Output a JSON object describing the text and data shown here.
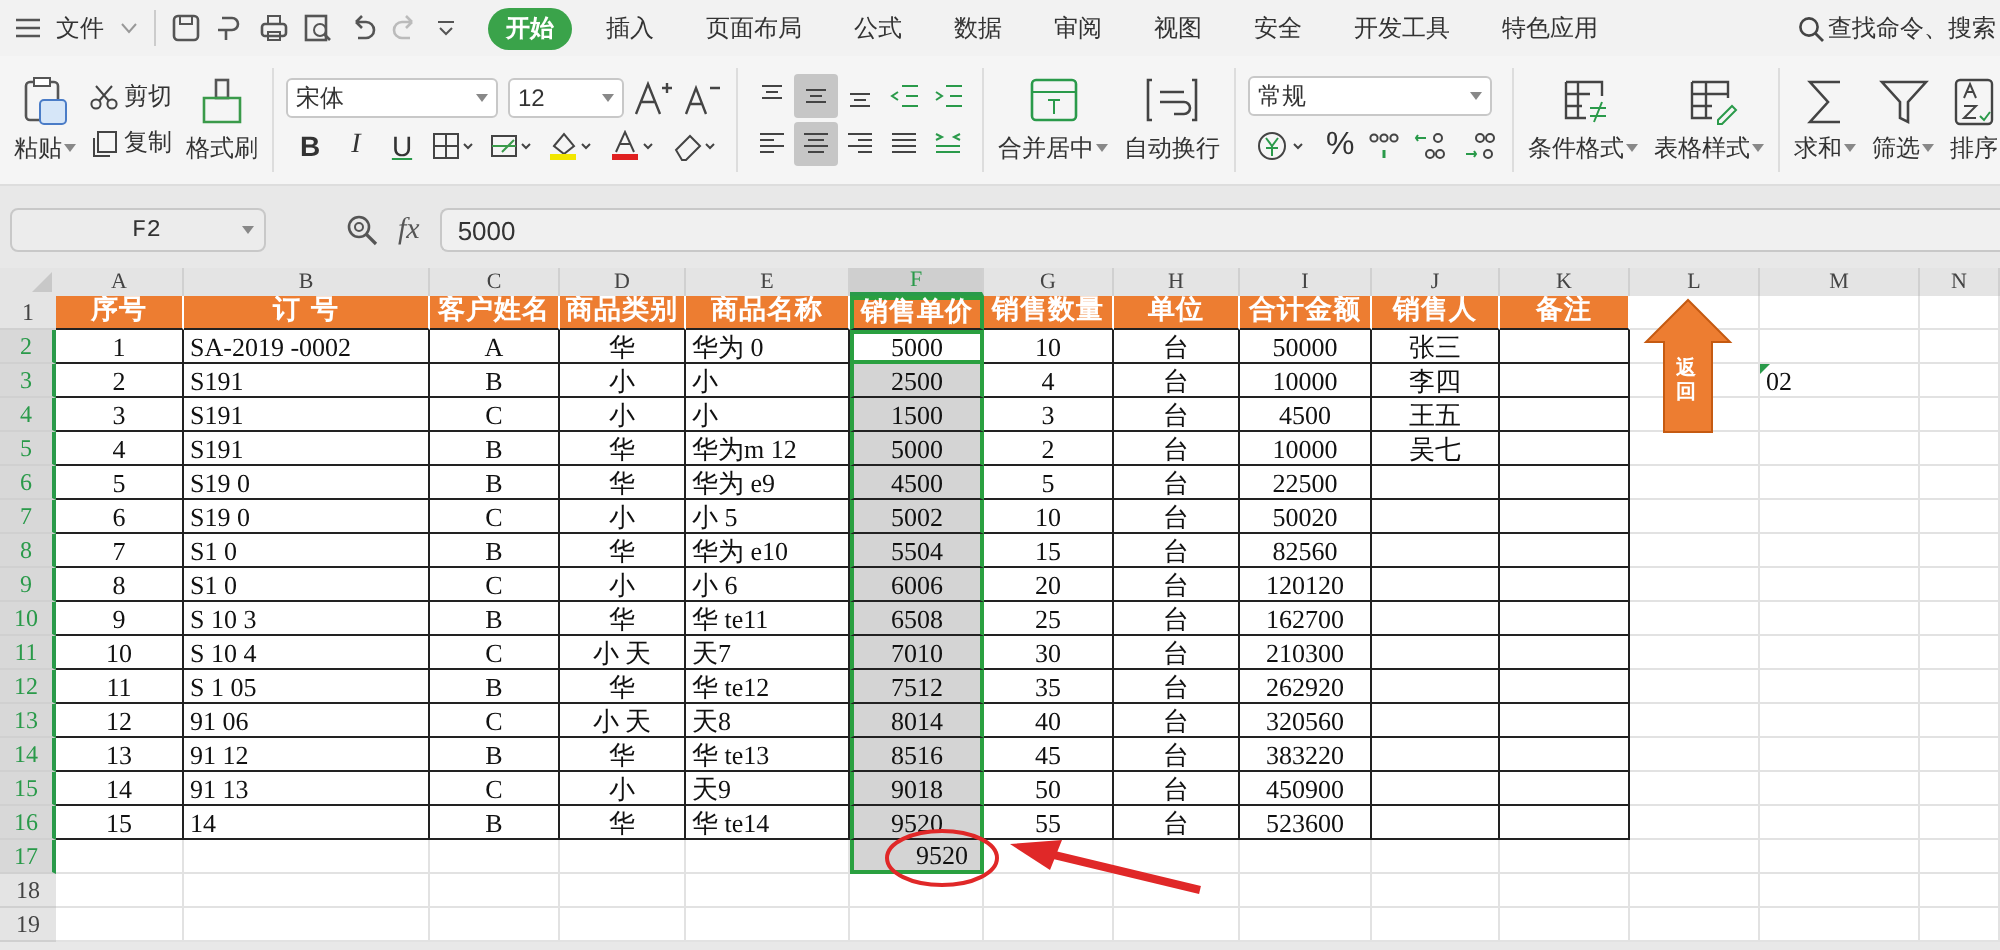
{
  "menu": {
    "file": "文件",
    "tabs": [
      {
        "label": "开始",
        "selected": true
      },
      {
        "label": "插入",
        "selected": false
      },
      {
        "label": "页面布局",
        "selected": false
      },
      {
        "label": "公式",
        "selected": false
      },
      {
        "label": "数据",
        "selected": false
      },
      {
        "label": "审阅",
        "selected": false
      },
      {
        "label": "视图",
        "selected": false
      },
      {
        "label": "安全",
        "selected": false
      },
      {
        "label": "开发工具",
        "selected": false
      },
      {
        "label": "特色应用",
        "selected": false
      }
    ],
    "search": "查找命令、搜索"
  },
  "ribbon": {
    "paste": "粘贴",
    "cut": "剪切",
    "copy": "复制",
    "format_painter": "格式刷",
    "font": "宋体",
    "size": "12",
    "bold": "B",
    "italic": "I",
    "underline": "U",
    "align": [
      {
        "kind": "top",
        "selected": false
      },
      {
        "kind": "middle",
        "selected": true
      },
      {
        "kind": "bottom",
        "selected": false
      },
      {
        "kind": "outdent",
        "selected": false
      },
      {
        "kind": "indent",
        "selected": false
      },
      {
        "kind": "left",
        "selected": false
      },
      {
        "kind": "center",
        "selected": true
      },
      {
        "kind": "right",
        "selected": false
      },
      {
        "kind": "justify",
        "selected": false
      },
      {
        "kind": "distribute",
        "selected": false
      }
    ],
    "merge": "合并居中",
    "wrap": "自动换行",
    "number_format": "常规",
    "percent": "%",
    "conditional": "条件格式",
    "table_style": "表格样式",
    "sum": "求和",
    "filter": "筛选",
    "sort": "排序"
  },
  "formula_bar": {
    "cell": "F2",
    "fx": "fx",
    "value": "5000"
  },
  "sheet": {
    "columns": [
      {
        "letter": "A",
        "selected": false
      },
      {
        "letter": "B",
        "selected": false
      },
      {
        "letter": "C",
        "selected": false
      },
      {
        "letter": "D",
        "selected": false
      },
      {
        "letter": "E",
        "selected": false
      },
      {
        "letter": "F",
        "selected": true
      },
      {
        "letter": "G",
        "selected": false
      },
      {
        "letter": "H",
        "selected": false
      },
      {
        "letter": "I",
        "selected": false
      },
      {
        "letter": "J",
        "selected": false
      },
      {
        "letter": "K",
        "selected": false
      },
      {
        "letter": "L",
        "selected": false
      },
      {
        "letter": "M",
        "selected": false
      },
      {
        "letter": "N",
        "selected": false
      }
    ],
    "header": {
      "number": "1",
      "cells": [
        "序号",
        "订 号",
        "客户姓名",
        "商品类别",
        "商品名称",
        "销售单价",
        "销售数量",
        "单位",
        "合计金额",
        "销售人",
        "备注"
      ]
    },
    "rows": [
      {
        "kind": "data",
        "number": "2",
        "selected": true,
        "active": true,
        "no": "1",
        "order": "SA-2019 -0002",
        "customer": "A",
        "category": "华",
        "product": "华为 0",
        "price": "5000",
        "qty": "10",
        "unit": "台",
        "total": "50000",
        "seller": "张三"
      },
      {
        "kind": "data",
        "number": "3",
        "selected": true,
        "active": false,
        "no": "2",
        "order": "S191",
        "customer": "B",
        "category": "小",
        "product": "小",
        "price": "2500",
        "qty": "4",
        "unit": "台",
        "total": "10000",
        "seller": "李四",
        "column_m": "02"
      },
      {
        "kind": "data",
        "number": "4",
        "selected": true,
        "active": false,
        "no": "3",
        "order": "S191",
        "customer": "C",
        "category": "小",
        "product": "小",
        "price": "1500",
        "qty": "3",
        "unit": "台",
        "total": "4500",
        "seller": "王五"
      },
      {
        "kind": "data",
        "number": "5",
        "selected": true,
        "active": false,
        "no": "4",
        "order": "S191",
        "customer": "B",
        "category": "华",
        "product": "华为m 12",
        "price": "5000",
        "qty": "2",
        "unit": "台",
        "total": "10000",
        "seller": "吴七"
      },
      {
        "kind": "data",
        "number": "6",
        "selected": true,
        "active": false,
        "no": "5",
        "order": "S19 0",
        "customer": "B",
        "category": "华",
        "product": "华为 e9",
        "price": "4500",
        "qty": "5",
        "unit": "台",
        "total": "22500"
      },
      {
        "kind": "data",
        "number": "7",
        "selected": true,
        "active": false,
        "no": "6",
        "order": "S19 0",
        "customer": "C",
        "category": "小",
        "product": "小 5",
        "price": "5002",
        "qty": "10",
        "unit": "台",
        "total": "50020"
      },
      {
        "kind": "data",
        "number": "8",
        "selected": true,
        "active": false,
        "no": "7",
        "order": "S1 0",
        "customer": "B",
        "category": "华",
        "product": "华为 e10",
        "price": "5504",
        "qty": "15",
        "unit": "台",
        "total": "82560"
      },
      {
        "kind": "data",
        "number": "9",
        "selected": true,
        "active": false,
        "no": "8",
        "order": "S1 0",
        "customer": "C",
        "category": "小",
        "product": "小 6",
        "price": "6006",
        "qty": "20",
        "unit": "台",
        "total": "120120"
      },
      {
        "kind": "data",
        "number": "10",
        "selected": true,
        "active": false,
        "no": "9",
        "order": "S 10 3",
        "customer": "B",
        "category": "华",
        "product": "华 te11",
        "price": "6508",
        "qty": "25",
        "unit": "台",
        "total": "162700"
      },
      {
        "kind": "data",
        "number": "11",
        "selected": true,
        "active": false,
        "no": "10",
        "order": "S 10 4",
        "customer": "C",
        "category": "小 天",
        "product": "天7",
        "price": "7010",
        "qty": "30",
        "unit": "台",
        "total": "210300"
      },
      {
        "kind": "data",
        "number": "12",
        "selected": true,
        "active": false,
        "no": "11",
        "order": "S 1 05",
        "customer": "B",
        "category": "华",
        "product": "华 te12",
        "price": "7512",
        "qty": "35",
        "unit": "台",
        "total": "262920"
      },
      {
        "kind": "data",
        "number": "13",
        "selected": true,
        "active": false,
        "no": "12",
        "order": "91 06",
        "customer": "C",
        "category": "小 天",
        "product": "天8",
        "price": "8014",
        "qty": "40",
        "unit": "台",
        "total": "320560"
      },
      {
        "kind": "data",
        "number": "14",
        "selected": true,
        "active": false,
        "no": "13",
        "order": "91 12",
        "customer": "B",
        "category": "华",
        "product": "华 te13",
        "price": "8516",
        "qty": "45",
        "unit": "台",
        "total": "383220"
      },
      {
        "kind": "data",
        "number": "15",
        "selected": true,
        "active": false,
        "no": "14",
        "order": "91 13",
        "customer": "C",
        "category": "小",
        "product": "天9",
        "price": "9018",
        "qty": "50",
        "unit": "台",
        "total": "450900"
      },
      {
        "kind": "data",
        "number": "16",
        "selected": true,
        "active": false,
        "no": "15",
        "order": "14",
        "customer": "B",
        "category": "华",
        "product": "华 te14",
        "price": "9520",
        "qty": "55",
        "unit": "台",
        "total": "523600"
      },
      {
        "kind": "blank",
        "number": "17",
        "selected": true,
        "active": false,
        "price": "9520"
      },
      {
        "kind": "blank",
        "number": "18",
        "selected": false
      },
      {
        "kind": "blank",
        "number": "19",
        "selected": false
      }
    ],
    "back_button": "返回"
  }
}
